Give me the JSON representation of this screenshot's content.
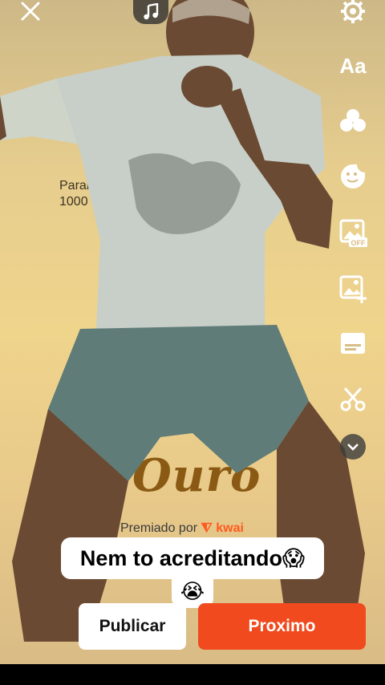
{
  "background": {
    "congrats_line1": "Parabé",
    "congrats_line2": "1000 s",
    "medal_word": "Ouro",
    "premiado_label": "Premiado por",
    "brand": "kwai"
  },
  "top": {
    "close_icon": "close-icon",
    "music_icon": "music-note-icon"
  },
  "toolbar": {
    "items": [
      {
        "name": "settings-icon"
      },
      {
        "name": "text-tool",
        "label": "Aa"
      },
      {
        "name": "filter-icon"
      },
      {
        "name": "sticker-icon"
      },
      {
        "name": "image-off-icon"
      },
      {
        "name": "add-image-icon"
      },
      {
        "name": "caption-icon"
      },
      {
        "name": "scissors-icon"
      },
      {
        "name": "expand-more-icon"
      }
    ]
  },
  "caption": {
    "text": "Nem to acreditando😱",
    "tail": "😭"
  },
  "actions": {
    "publish_label": "Publicar",
    "next_label": "Proximo"
  },
  "colors": {
    "accent": "#f04a1e",
    "brand_kwai": "#ff5a1f"
  }
}
